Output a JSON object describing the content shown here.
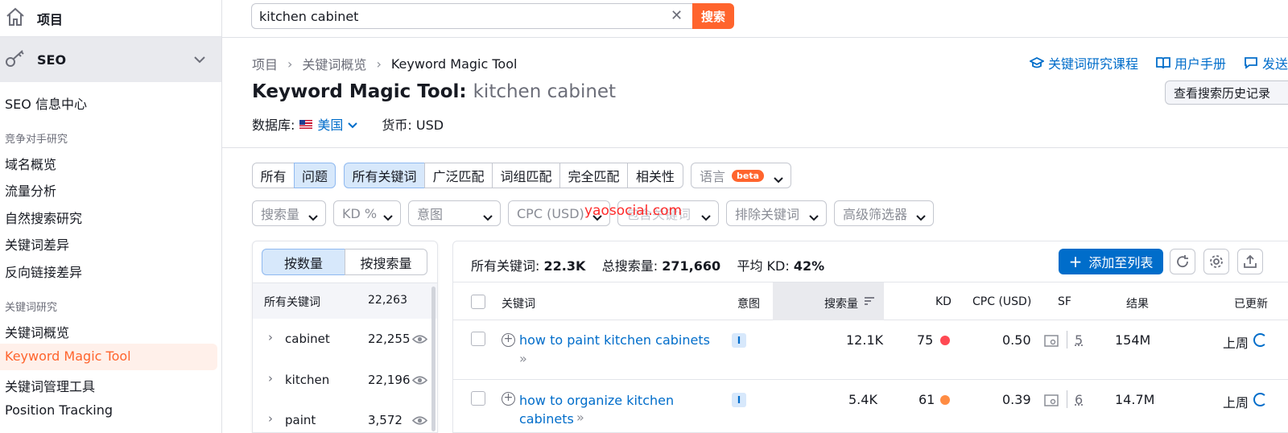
{
  "sidebar": {
    "project_label": "项目",
    "seo_label": "SEO",
    "items": [
      {
        "label": "SEO 信息中心"
      },
      {
        "section": "竞争对手研究"
      },
      {
        "label": "域名概览"
      },
      {
        "label": "流量分析"
      },
      {
        "label": "自然搜索研究"
      },
      {
        "label": "关键词差异"
      },
      {
        "label": "反向链接差异"
      },
      {
        "section": "关键词研究"
      },
      {
        "label": "关键词概览"
      },
      {
        "label": "Keyword Magic Tool",
        "active": true
      },
      {
        "label": "关键词管理工具"
      },
      {
        "label": "Position Tracking"
      }
    ]
  },
  "search": {
    "value": "kitchen cabinet",
    "clear_icon": "✕",
    "button_label": "搜索"
  },
  "breadcrumb": [
    "项目",
    "关键词概览",
    "Keyword Magic Tool"
  ],
  "header": {
    "title": "Keyword Magic Tool:",
    "keyword": "kitchen cabinet",
    "db_label": "数据库:",
    "country": "美国",
    "currency": "货币: USD",
    "links": [
      "关键词研究课程",
      "用户手册",
      "发送"
    ],
    "history_button": "查看搜索历史记录"
  },
  "filters": {
    "match_tabs": [
      "所有",
      "问题"
    ],
    "keyword_tabs": [
      "所有关键词",
      "广泛匹配",
      "词组匹配",
      "完全匹配",
      "相关性"
    ],
    "language": "语言",
    "beta": "beta",
    "dropdowns": [
      "搜索量",
      "KD %",
      "意图",
      "CPC (USD)",
      "包含关键词",
      "排除关键词",
      "高级筛选器"
    ]
  },
  "watermark": "yaosocial.com",
  "groups_panel": {
    "toggle": [
      "按数量",
      "按搜索量"
    ],
    "header": {
      "label": "所有关键词",
      "count": "22,263"
    },
    "rows": [
      {
        "name": "cabinet",
        "count": "22,255"
      },
      {
        "name": "kitchen",
        "count": "22,196"
      },
      {
        "name": "paint",
        "count": "3,572"
      }
    ]
  },
  "results": {
    "stats": {
      "all_label": "所有关键词:",
      "all_value": "22.3K",
      "volume_label": "总搜索量:",
      "volume_value": "271,660",
      "kd_label": "平均 KD:",
      "kd_value": "42%"
    },
    "add_button": "添加至列表",
    "columns": [
      "关键词",
      "意图",
      "搜索量",
      "KD",
      "CPC (USD)",
      "SF",
      "结果",
      "已更新"
    ],
    "rows": [
      {
        "keyword_line1": "how to paint kitchen cabinets",
        "keyword_line2": "",
        "intent": "I",
        "volume": "12.1K",
        "kd": "75",
        "kd_color": "#ff4953",
        "cpc": "0.50",
        "sf": "5",
        "results": "154M",
        "updated": "上周"
      },
      {
        "keyword_line1": "how to organize kitchen",
        "keyword_line2": "cabinets",
        "intent": "I",
        "volume": "5.4K",
        "kd": "61",
        "kd_color": "#ff8c43",
        "cpc": "0.39",
        "sf": "6",
        "results": "14.7M",
        "updated": "上周"
      }
    ]
  },
  "colors": {
    "accent": "#ff642d",
    "link": "#006dca",
    "selected": "#d7e8fb"
  }
}
